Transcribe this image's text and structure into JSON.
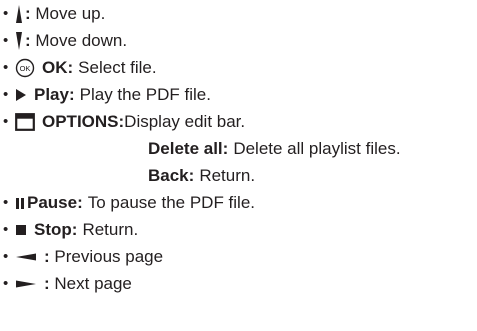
{
  "items": [
    {
      "key": "",
      "desc": ": Move up.",
      "icon": "up-arrow-icon"
    },
    {
      "key": "",
      "desc": ": Move down.",
      "icon": "down-arrow-icon"
    },
    {
      "key": "OK:",
      "desc": "Select file.",
      "icon": "ok-button-icon"
    },
    {
      "key": "Play:",
      "desc": "Play the PDF file.",
      "icon": "play-icon"
    },
    {
      "key": "OPTIONS:",
      "desc": "Display edit bar.",
      "icon": "options-icon"
    },
    {
      "key": "Pause:",
      "desc": "To pause the PDF file.",
      "icon": "pause-icon"
    },
    {
      "key": "Stop:",
      "desc": "Return.",
      "icon": "stop-icon"
    },
    {
      "key": "",
      "desc": ": Previous page",
      "icon": "left-arrow-icon"
    },
    {
      "key": "",
      "desc": ": Next page",
      "icon": "right-arrow-icon"
    }
  ],
  "options_sub": [
    {
      "key": "Delete all:",
      "desc": "Delete all playlist files."
    },
    {
      "key": "Back:",
      "desc": "Return."
    }
  ],
  "ok_icon_text": "OK",
  "bullet": "•"
}
